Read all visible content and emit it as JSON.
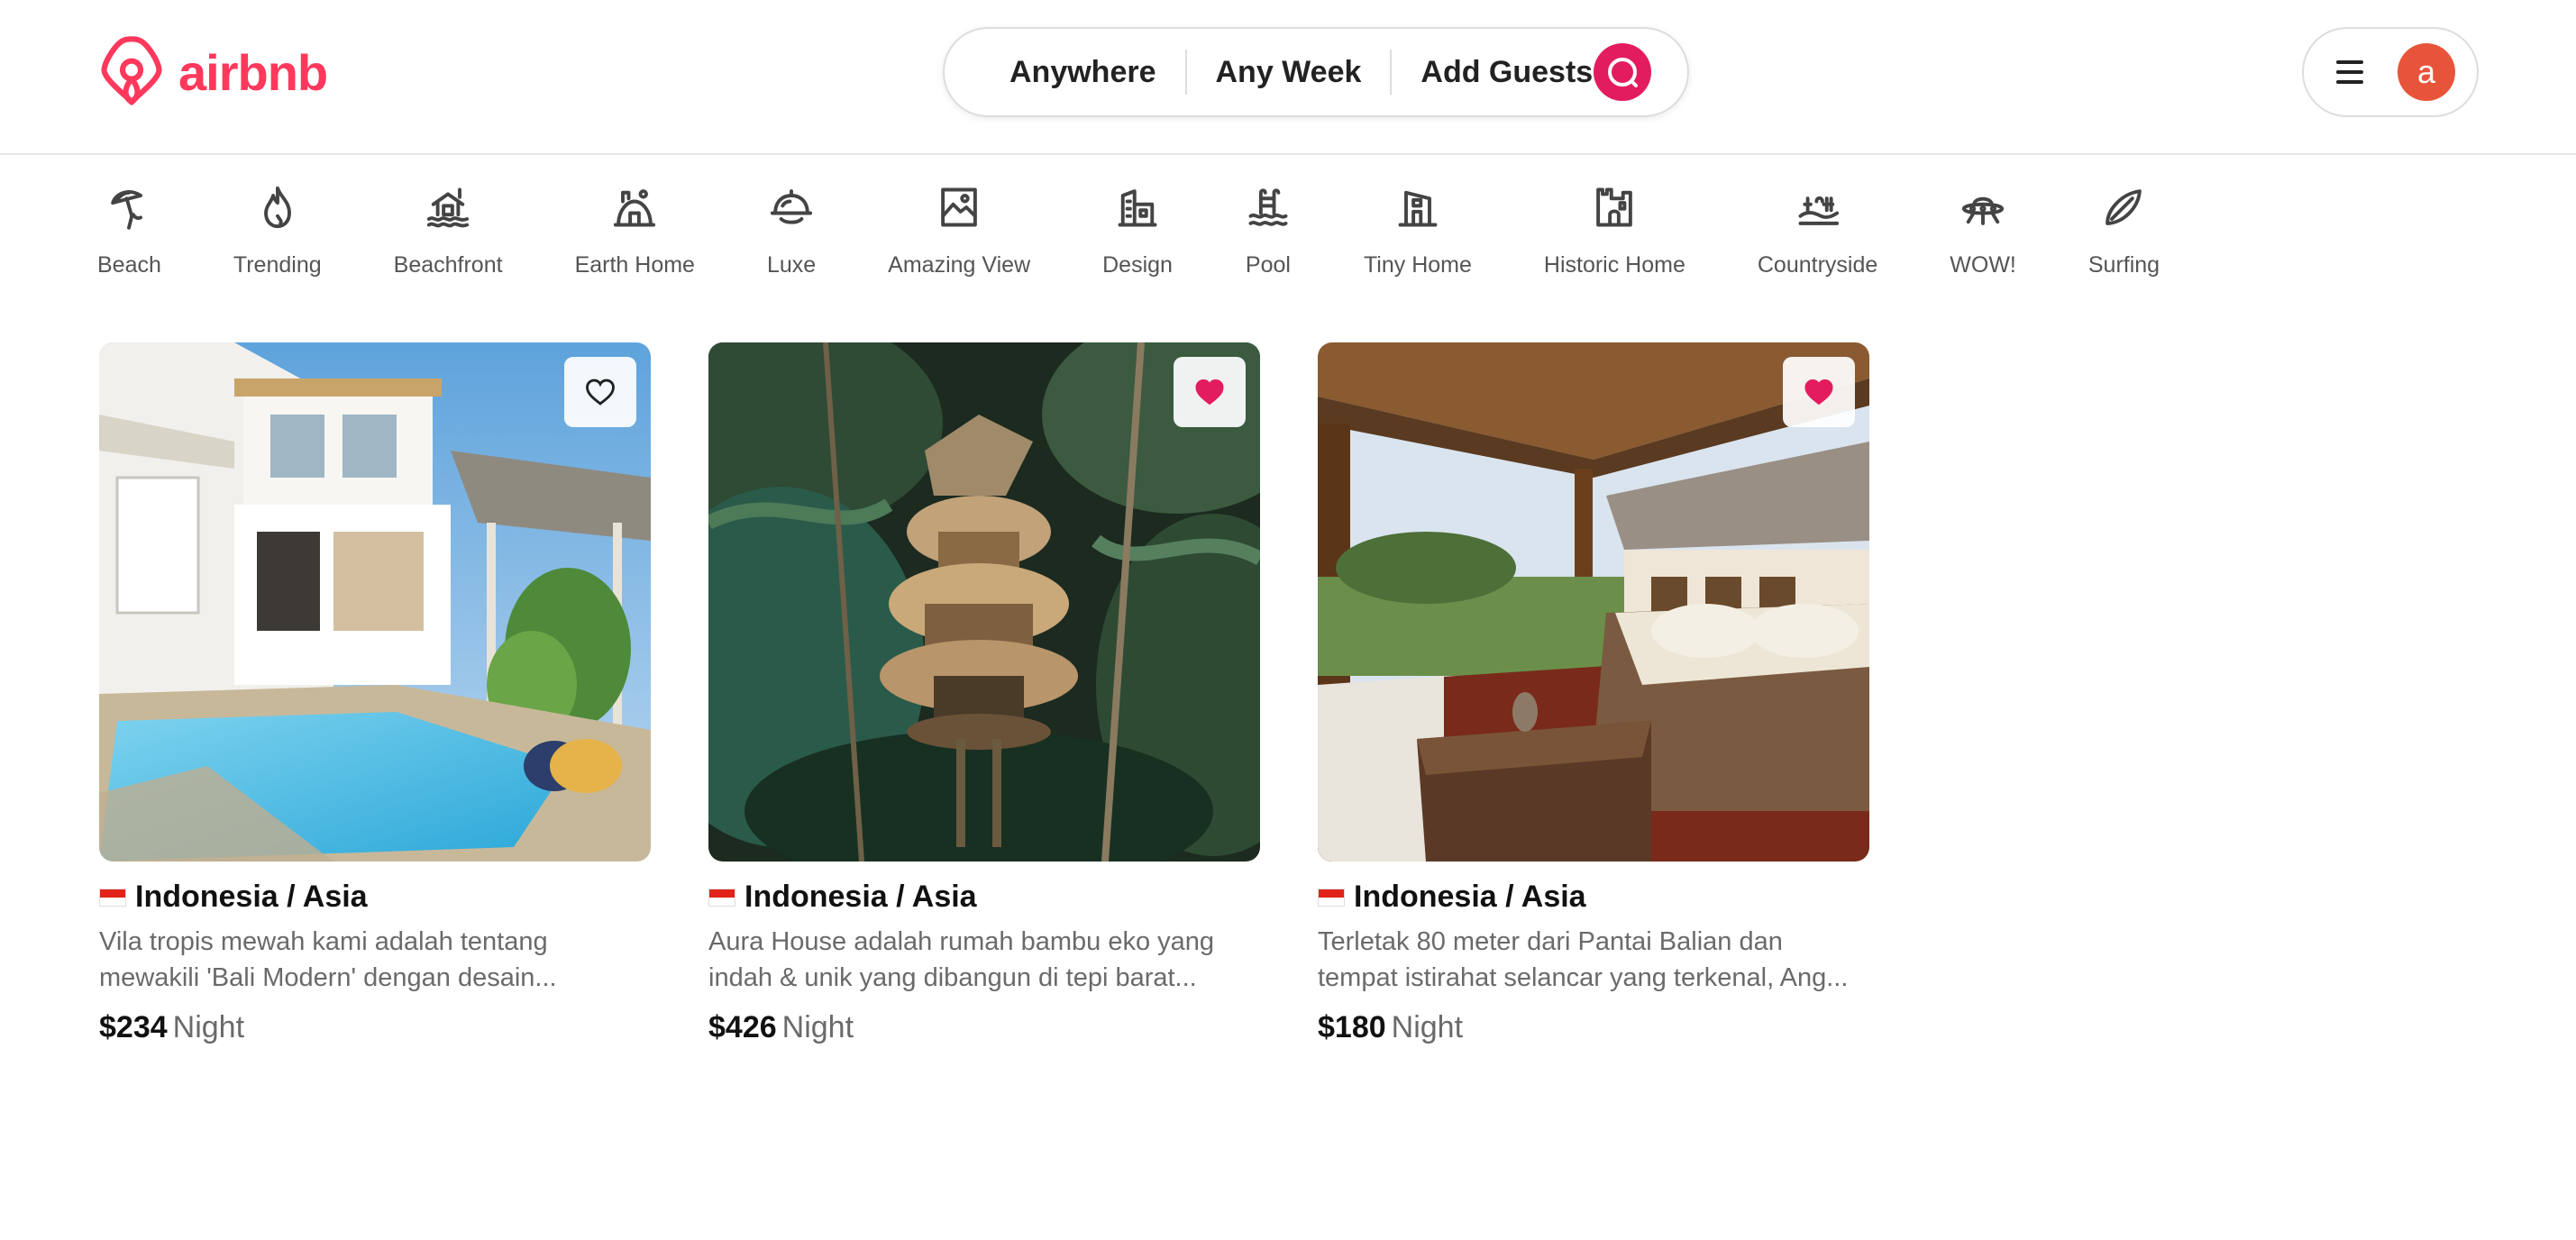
{
  "brand": {
    "name": "airbnb",
    "color": "#ff385c"
  },
  "search": {
    "where": "Anywhere",
    "when": "Any Week",
    "guests": "Add Guests",
    "button_color": "#e31c5f"
  },
  "user_menu": {
    "avatar_letter": "a",
    "avatar_color": "#e8543a"
  },
  "categories": [
    {
      "label": "Beach",
      "icon": "beach-umbrella-icon"
    },
    {
      "label": "Trending",
      "icon": "flame-icon"
    },
    {
      "label": "Beachfront",
      "icon": "beachfront-house-icon"
    },
    {
      "label": "Earth Home",
      "icon": "earth-home-icon"
    },
    {
      "label": "Luxe",
      "icon": "luxe-cloche-icon"
    },
    {
      "label": "Amazing View",
      "icon": "picture-frame-icon"
    },
    {
      "label": "Design",
      "icon": "design-building-icon"
    },
    {
      "label": "Pool",
      "icon": "pool-ladder-icon"
    },
    {
      "label": "Tiny Home",
      "icon": "tiny-home-icon"
    },
    {
      "label": "Historic Home",
      "icon": "castle-icon"
    },
    {
      "label": "Countryside",
      "icon": "countryside-icon"
    },
    {
      "label": "WOW!",
      "icon": "ufo-icon"
    },
    {
      "label": "Surfing",
      "icon": "surfboard-icon"
    }
  ],
  "listings": [
    {
      "location": "Indonesia / Asia",
      "description": "Vila tropis mewah kami adalah tentang mewakili 'Bali Modern' dengan desain...",
      "price": "$234",
      "unit": "Night",
      "favorited": false,
      "photo": "villa-with-pool"
    },
    {
      "location": "Indonesia / Asia",
      "description": "Aura House adalah rumah bambu eko yang indah & unik yang dibangun di tepi barat...",
      "price": "$426",
      "unit": "Night",
      "favorited": true,
      "photo": "bamboo-treehouse-in-jungle"
    },
    {
      "location": "Indonesia / Asia",
      "description": "Terletak 80 meter dari Pantai Balian dan tempat istirahat selancar yang terkenal, Ang...",
      "price": "$180",
      "unit": "Night",
      "favorited": true,
      "photo": "gazebo-lounge-with-sofa"
    }
  ]
}
